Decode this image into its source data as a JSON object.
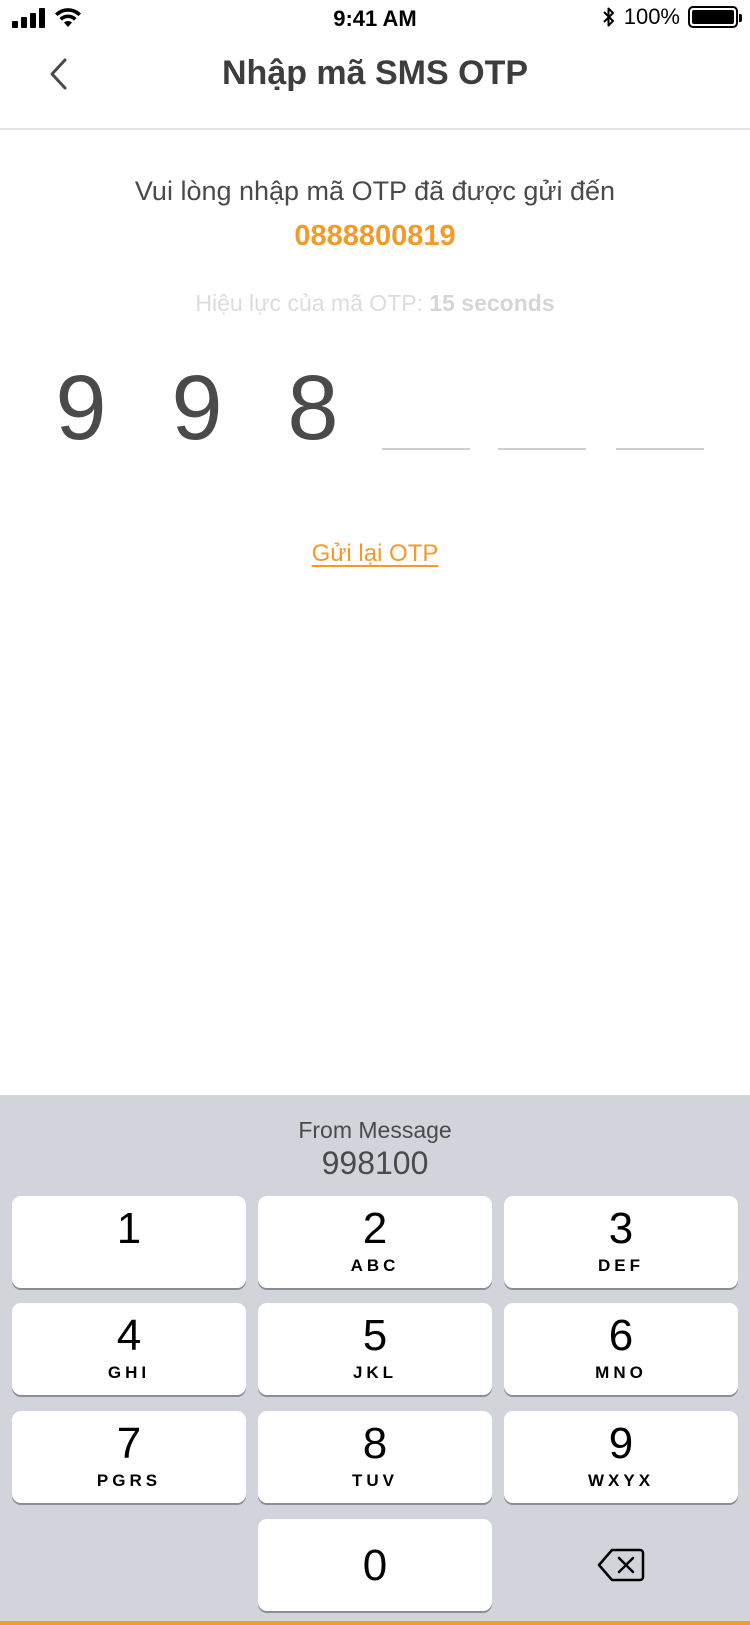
{
  "status": {
    "time": "9:41 AM",
    "battery_text": "100%",
    "battery_level": 1.0,
    "icons": [
      "signal-icon",
      "wifi-icon",
      "bluetooth-icon",
      "battery-icon"
    ]
  },
  "header": {
    "title": "Nhập mã SMS OTP",
    "back_icon": "chevron-left-icon"
  },
  "content": {
    "instruction": "Vui lòng nhập mã OTP đã được gửi đến",
    "phone": "0888800819",
    "validity_label": "Hiệu lực của mã OTP:",
    "validity_value": "15 seconds",
    "otp_digits": [
      "9",
      "9",
      "8",
      "",
      "",
      ""
    ],
    "resend_label": "Gửi lại OTP"
  },
  "keyboard": {
    "suggestion_label": "From Message",
    "suggestion_code": "998100",
    "keys": [
      {
        "num": "1",
        "letters": ""
      },
      {
        "num": "2",
        "letters": "ABC"
      },
      {
        "num": "3",
        "letters": "DEF"
      },
      {
        "num": "4",
        "letters": "GHI"
      },
      {
        "num": "5",
        "letters": "JKL"
      },
      {
        "num": "6",
        "letters": "MNO"
      },
      {
        "num": "7",
        "letters": "PGRS"
      },
      {
        "num": "8",
        "letters": "TUV"
      },
      {
        "num": "9",
        "letters": "WXYX"
      }
    ],
    "zero": "0",
    "delete_icon": "backspace-icon"
  },
  "colors": {
    "accent": "#f39a2a",
    "text": "#4a4a4a",
    "keyboard_bg": "#d1d5db"
  }
}
